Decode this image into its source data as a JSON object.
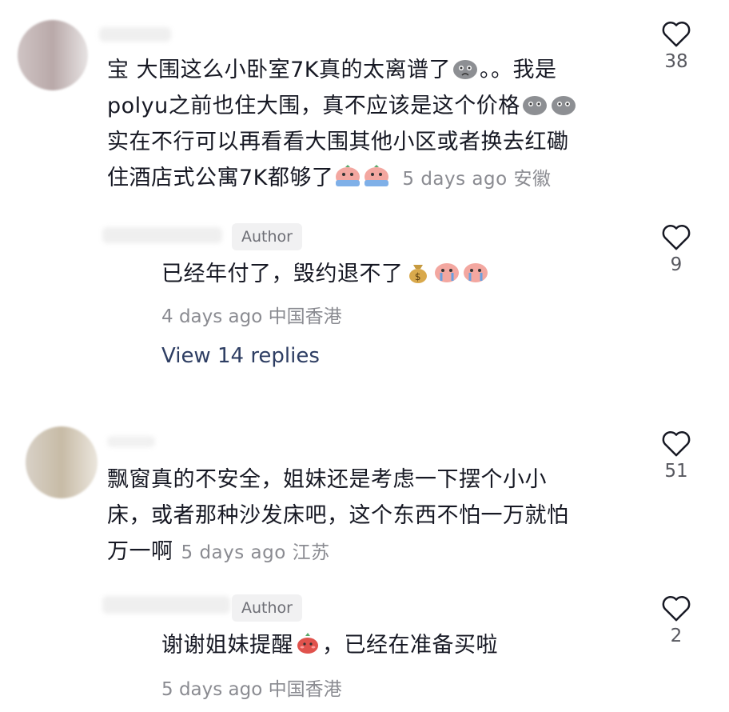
{
  "comments": [
    {
      "lines": [
        "宝 大围这么小卧室7K真的太离谱了",
        "。。我是",
        "polyu之前也住大围，真不应该是这个价格",
        "实在不行可以再看看大围其他小区或者换去红磡",
        "住酒店式公寓7K都够了"
      ],
      "meta": "5 days ago 安徽",
      "likes": "38"
    },
    {
      "author_badge": "Author",
      "text": "已经年付了，毁约退不了",
      "meta": "4 days ago 中国香港",
      "likes": "9",
      "view_replies": "View 14 replies"
    },
    {
      "lines": [
        "飘窗真的不安全，姐妹还是考虑一下摆个小小",
        "床，或者那种沙发床吧，这个东西不怕一万就怕",
        "万一啊"
      ],
      "meta": "5 days ago 江苏",
      "likes": "51"
    },
    {
      "author_badge": "Author",
      "text_a": "谢谢姐妹提醒",
      "text_b": "，已经在准备买啦",
      "meta": "5 days ago 中国香港",
      "likes": "2"
    }
  ]
}
